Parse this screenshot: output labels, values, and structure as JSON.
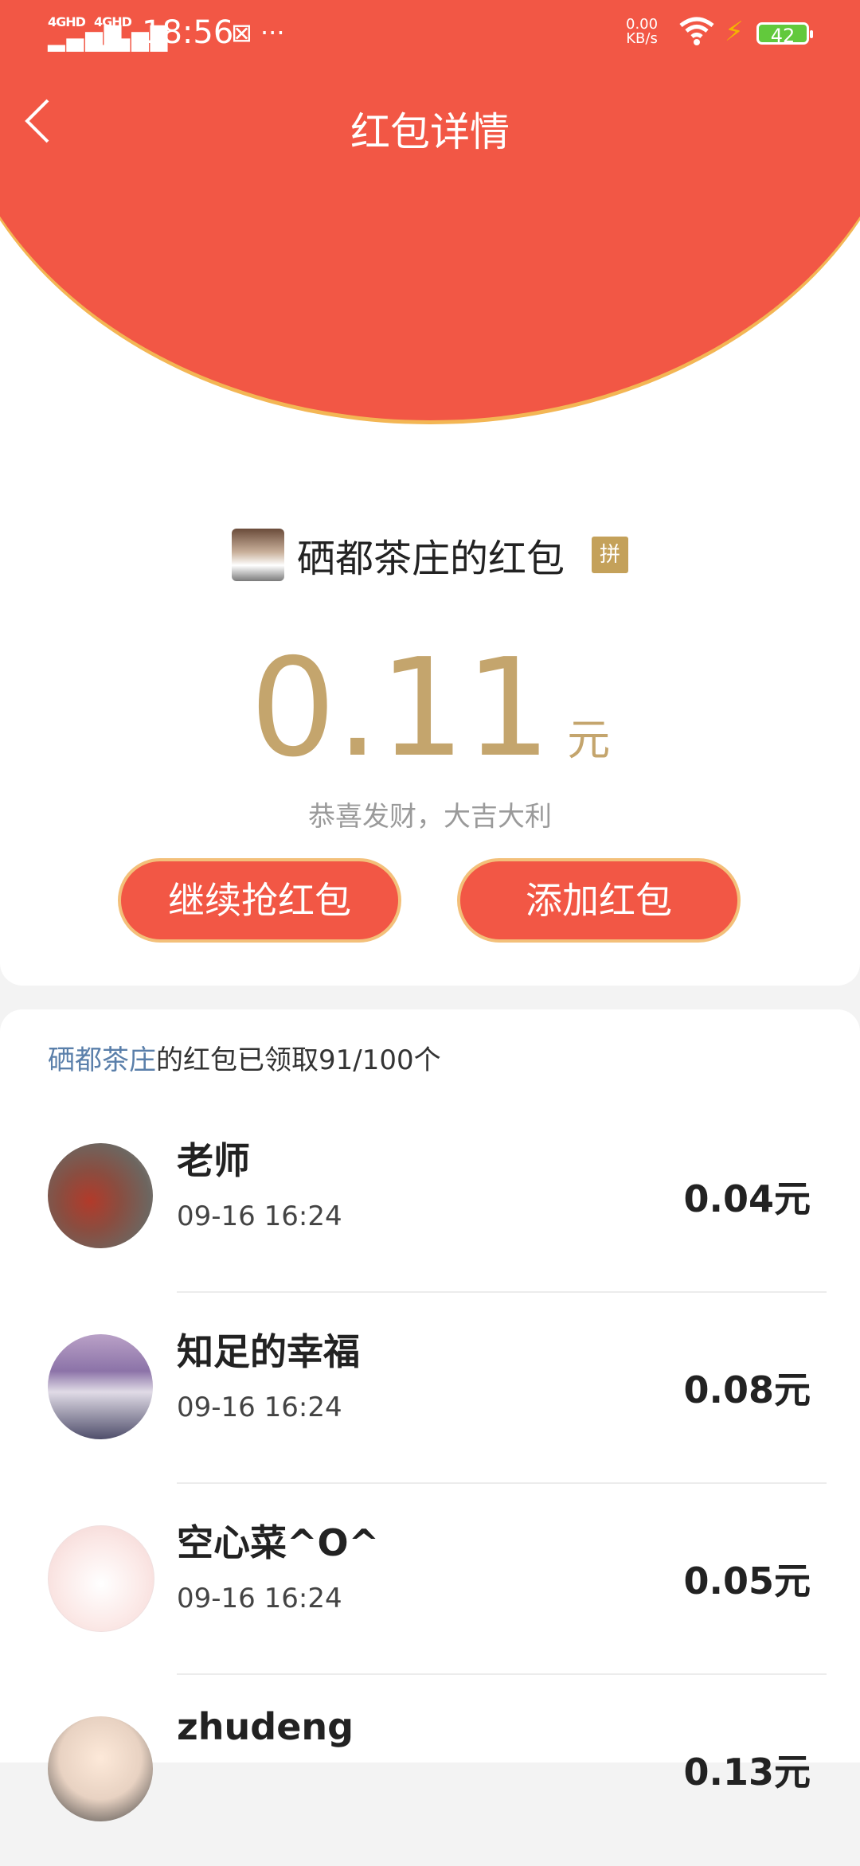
{
  "status_bar": {
    "signal1": "4GHD",
    "signal2": "4GHD",
    "time": "18:56",
    "extra_icons": "⊠ ···",
    "net_speed_value": "0.00",
    "net_speed_unit": "KB/s",
    "battery": "42"
  },
  "header": {
    "title": "红包详情"
  },
  "sender": {
    "name": "硒都茶庄的红包",
    "badge": "拼"
  },
  "amount": {
    "value": "0.11",
    "unit": "元"
  },
  "blessing": "恭喜发财，大吉大利",
  "buttons": {
    "continue": "继续抢红包",
    "add": "添加红包"
  },
  "summary": {
    "owner": "硒都茶庄",
    "text": "的红包已领取91/100个"
  },
  "records": [
    {
      "name": "老师",
      "time": "09-16 16:24",
      "amount": "0.04元"
    },
    {
      "name": "知足的幸福",
      "time": "09-16 16:24",
      "amount": "0.08元"
    },
    {
      "name": "空心菜^O^",
      "time": "09-16 16:24",
      "amount": "0.05元"
    },
    {
      "name": "zhudeng",
      "time": "",
      "amount": "0.13元"
    }
  ]
}
